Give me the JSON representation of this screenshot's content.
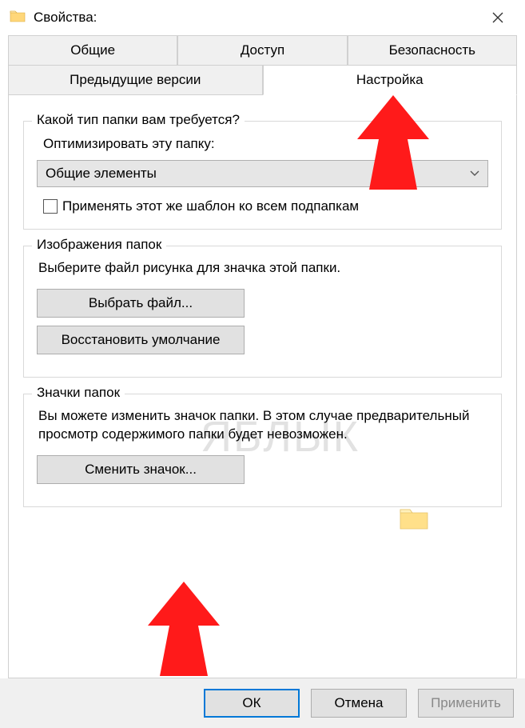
{
  "titlebar": {
    "title": "Свойства:"
  },
  "tabs": {
    "row1": [
      "Общие",
      "Доступ",
      "Безопасность"
    ],
    "row2": [
      "Предыдущие версии",
      "Настройка"
    ],
    "active": "Настройка"
  },
  "group_type": {
    "label": "Какой тип папки вам требуется?",
    "optimize_label": "Оптимизировать эту папку:",
    "select_value": "Общие элементы",
    "checkbox_label": "Применять этот же шаблон ко всем подпапкам"
  },
  "group_images": {
    "label": "Изображения папок",
    "desc": "Выберите файл рисунка для значка этой папки.",
    "choose_btn": "Выбрать файл...",
    "restore_btn": "Восстановить умолчание"
  },
  "group_icons": {
    "label": "Значки папок",
    "desc": "Вы можете изменить значок папки. В этом случае предварительный просмотр содержимого папки будет невозможен.",
    "change_btn": "Сменить значок..."
  },
  "buttons": {
    "ok": "ОК",
    "cancel": "Отмена",
    "apply": "Применить"
  },
  "watermark": "ЯБЛЫК"
}
